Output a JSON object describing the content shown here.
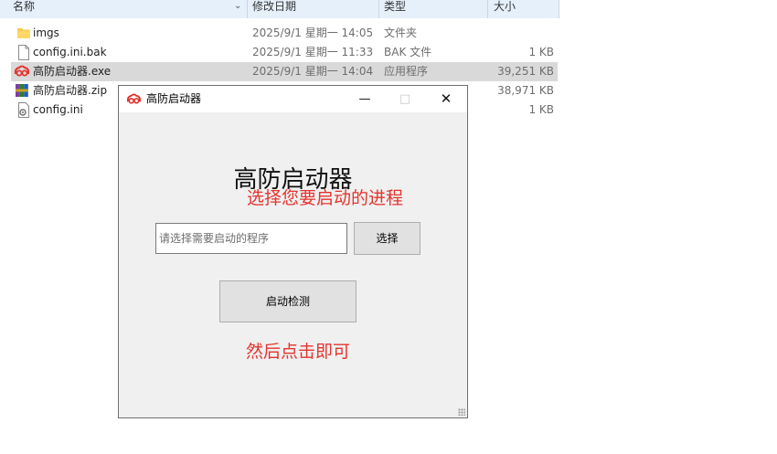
{
  "explorer": {
    "columns": {
      "name": "名称",
      "date": "修改日期",
      "type": "类型",
      "size": "大小"
    },
    "files": [
      {
        "name": "imgs",
        "date": "2025/9/1 星期一 14:05",
        "type": "文件夹",
        "size": "",
        "icon": "folder-icon"
      },
      {
        "name": "config.ini.bak",
        "date": "2025/9/1 星期一 11:33",
        "type": "BAK 文件",
        "size": "1 KB",
        "icon": "blank-file-icon"
      },
      {
        "name": "高防启动器.exe",
        "date": "2025/9/1 星期一 14:04",
        "type": "应用程序",
        "size": "39,251 KB",
        "icon": "app-logo-icon"
      },
      {
        "name": "高防启动器.zip",
        "date": "",
        "type": "",
        "size": "38,971 KB",
        "icon": "archive-icon"
      },
      {
        "name": "config.ini",
        "date": "",
        "type": "",
        "size": "1 KB",
        "icon": "settings-file-icon"
      }
    ]
  },
  "dialog": {
    "window_title": "高防启动器",
    "minimize": "—",
    "maximize": "□",
    "close": "✕",
    "heading": "高防启动器",
    "instruction": "选择您要启动的进程",
    "input_placeholder": "请选择需要启动的程序",
    "select_button": "选择",
    "start_button": "启动检测",
    "hint": "然后点击即可"
  },
  "colors": {
    "accent_red": "#e4342e",
    "header_blue": "#e5f0fb",
    "selection": "#d9d9d9"
  }
}
